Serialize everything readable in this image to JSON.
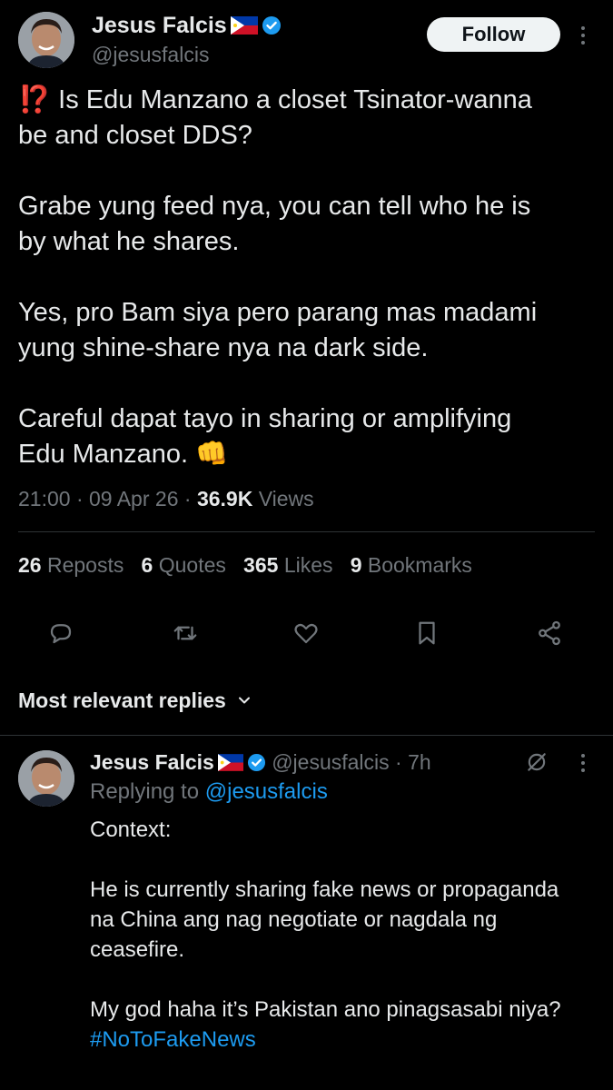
{
  "tweet": {
    "author_name": "Jesus Falcis",
    "author_handle": "@jesusfalcis",
    "follow_label": "Follow",
    "emoji_prefix": "⁉️",
    "text": " Is Edu Manzano a closet Tsinator-wanna\nbe and closet DDS?\n\nGrabe yung feed nya, you can tell who he is\nby what he shares.\n\nYes, pro Bam siya pero parang mas madami\nyung shine-share nya na dark side.\n\nCareful dapat tayo in sharing or amplifying\nEdu Manzano. ",
    "emoji_suffix": "👊",
    "time": "21:00",
    "sep1": "·",
    "date": "09 Apr 26",
    "sep2": "·",
    "views_count": "36.9K",
    "views_label": "Views"
  },
  "stats": {
    "reposts_count": "26",
    "reposts_label": "Reposts",
    "quotes_count": "6",
    "quotes_label": "Quotes",
    "likes_count": "365",
    "likes_label": "Likes",
    "bookmarks_count": "9",
    "bookmarks_label": "Bookmarks"
  },
  "actions": [
    "reply-icon",
    "repost-icon",
    "like-icon",
    "bookmark-icon",
    "share-icon"
  ],
  "replies_filter": {
    "label": "Most relevant replies"
  },
  "reply": {
    "author_name": "Jesus Falcis",
    "author_handle": "@jesusfalcis",
    "dot": "·",
    "time_ago": "7h",
    "replying_to_label": "Replying to",
    "replying_to_handle": "@jesusfalcis",
    "text": "Context:\n\nHe is currently sharing fake news or propaganda\nna China ang nag negotiate or nagdala ng\nceasefire.\n\nMy god haha it’s Pakistan ano pinagsasabi niya?\n",
    "hashtag": "#NoToFakeNews"
  },
  "colors": {
    "background": "#000000",
    "text": "#e7e9ea",
    "muted": "#71767b",
    "accent": "#1d9bf0",
    "divider": "#2f3336"
  }
}
